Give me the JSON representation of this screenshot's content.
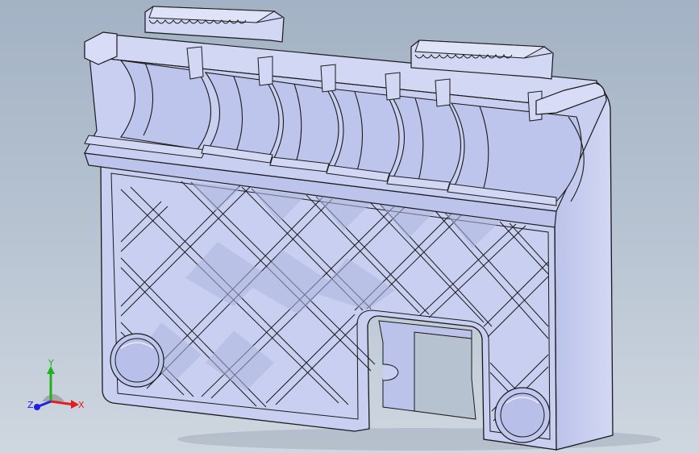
{
  "viewport": {
    "background_top": "#a3b2c4",
    "background_bottom": "#cfd7e0"
  },
  "model": {
    "face_color": "#c9cff0",
    "face_dark": "#aab2dc",
    "face_mid": "#bcc3ea",
    "edge_color": "#1a1a1a"
  },
  "triad": {
    "x_label": "X",
    "y_label": "Y",
    "z_label": "Z",
    "x_color": "#e02020",
    "y_color": "#20b020",
    "z_color": "#2020e0"
  }
}
